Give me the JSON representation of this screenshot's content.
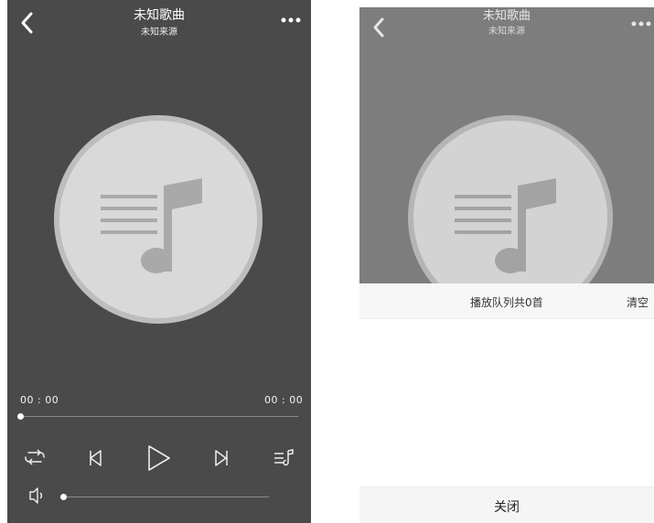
{
  "player": {
    "title": "未知歌曲",
    "subtitle": "未知来源",
    "current_time": "00 : 00",
    "total_time": "00 : 00",
    "progress": 0,
    "volume": 0,
    "icons": {
      "back": "back-chevron-icon",
      "more": "more-dots-icon",
      "artwork": "music-note-icon",
      "repeat": "repeat-icon",
      "previous": "previous-track-icon",
      "play": "play-icon",
      "next": "next-track-icon",
      "playlist": "playlist-icon",
      "volume": "volume-icon"
    }
  },
  "queue_sheet": {
    "title": "播放队列共0首",
    "clear_label": "清空",
    "close_label": "关闭"
  },
  "colors": {
    "player_bg": "#4a4a4a",
    "dimmed_bg": "#7d7d7d",
    "disc": "#d9d9d9",
    "disc_ring": "#bdbdbd",
    "note": "#a9a9a9"
  }
}
